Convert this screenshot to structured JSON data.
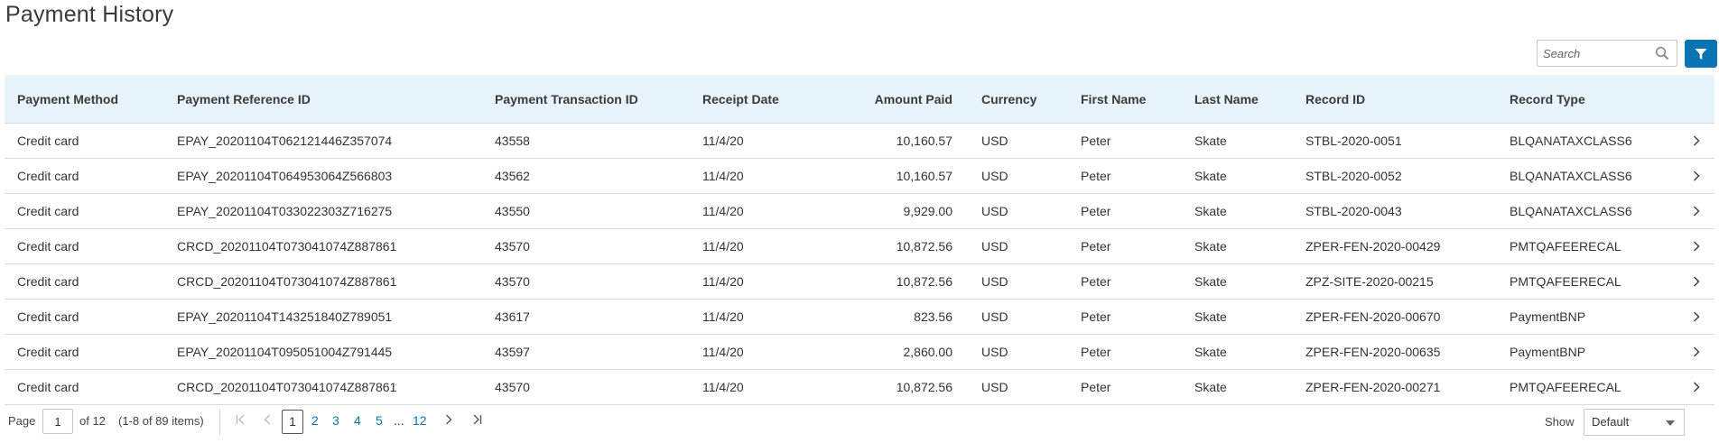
{
  "page": {
    "title": "Payment History"
  },
  "search": {
    "placeholder": "Search"
  },
  "icons": {
    "search": "search-icon",
    "filter": "filter-icon",
    "row_nav": "chevron-right-icon"
  },
  "colors": {
    "accent": "#0b73b4",
    "header_bg": "#e8f4fb"
  },
  "table": {
    "columns": [
      "Payment Method",
      "Payment Reference ID",
      "Payment Transaction ID",
      "Receipt Date",
      "Amount Paid",
      "Currency",
      "First Name",
      "Last Name",
      "Record ID",
      "Record Type"
    ],
    "rows": [
      [
        "Credit card",
        "EPAY_20201104T062121446Z357074",
        "43558",
        "11/4/20",
        "10,160.57",
        "USD",
        "Peter",
        "Skate",
        "STBL-2020-0051",
        "BLQANATAXCLASS6"
      ],
      [
        "Credit card",
        "EPAY_20201104T064953064Z566803",
        "43562",
        "11/4/20",
        "10,160.57",
        "USD",
        "Peter",
        "Skate",
        "STBL-2020-0052",
        "BLQANATAXCLASS6"
      ],
      [
        "Credit card",
        "EPAY_20201104T033022303Z716275",
        "43550",
        "11/4/20",
        "9,929.00",
        "USD",
        "Peter",
        "Skate",
        "STBL-2020-0043",
        "BLQANATAXCLASS6"
      ],
      [
        "Credit card",
        "CRCD_20201104T073041074Z887861",
        "43570",
        "11/4/20",
        "10,872.56",
        "USD",
        "Peter",
        "Skate",
        "ZPER-FEN-2020-00429",
        "PMTQAFEERECAL"
      ],
      [
        "Credit card",
        "CRCD_20201104T073041074Z887861",
        "43570",
        "11/4/20",
        "10,872.56",
        "USD",
        "Peter",
        "Skate",
        "ZPZ-SITE-2020-00215",
        "PMTQAFEERECAL"
      ],
      [
        "Credit card",
        "EPAY_20201104T143251840Z789051",
        "43617",
        "11/4/20",
        "823.56",
        "USD",
        "Peter",
        "Skate",
        "ZPER-FEN-2020-00670",
        "PaymentBNP"
      ],
      [
        "Credit card",
        "EPAY_20201104T095051004Z791445",
        "43597",
        "11/4/20",
        "2,860.00",
        "USD",
        "Peter",
        "Skate",
        "ZPER-FEN-2020-00635",
        "PaymentBNP"
      ],
      [
        "Credit card",
        "CRCD_20201104T073041074Z887861",
        "43570",
        "11/4/20",
        "10,872.56",
        "USD",
        "Peter",
        "Skate",
        "ZPER-FEN-2020-00271",
        "PMTQAFEERECAL"
      ]
    ]
  },
  "pagination": {
    "page_label": "Page",
    "current_page": "1",
    "of_label": "of 12",
    "range_label": "(1-8 of 89 items)",
    "pages": [
      "2",
      "3",
      "4",
      "5"
    ],
    "ellipsis": "...",
    "last_page": "12",
    "first_glyph": "K",
    "prev_glyph": "‹",
    "next_glyph": "›",
    "last_glyph": "K"
  },
  "show": {
    "label": "Show",
    "value": "Default"
  }
}
